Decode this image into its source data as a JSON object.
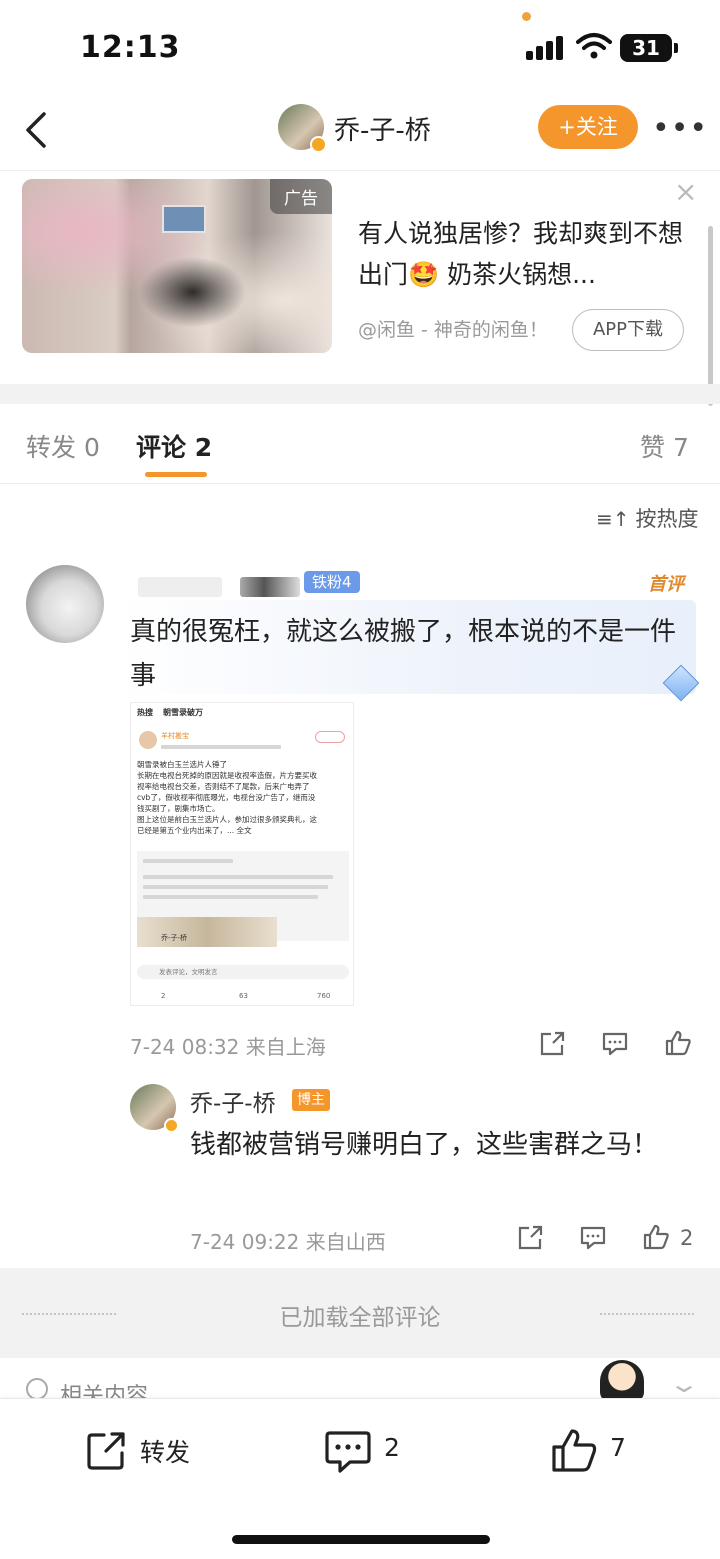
{
  "status_bar": {
    "time": "12:13",
    "battery": "31"
  },
  "nav": {
    "username": "乔-子-桥",
    "follow_label": "+关注",
    "more": "•••"
  },
  "ad": {
    "tag": "广告",
    "title": "有人说独居惨？我却爽到不想出门🤩 奶茶火锅想...",
    "source": "@闲鱼 - 神奇的闲鱼！",
    "download_label": "APP下载",
    "close": "×"
  },
  "tabs": {
    "repost": "转发 0",
    "comments": "评论 2",
    "likes": "赞 7"
  },
  "sort": {
    "icon": "≡↑",
    "label": "按热度"
  },
  "comment": {
    "fan_badge": "铁粉4",
    "first_tag": "首评",
    "text": "真的很冤枉，就这么被搬了，根本说的不是一件事",
    "meta": "7-24 08:32  来自上海",
    "screenshot": {
      "header_left": "热搜",
      "header_right": "朝雪录破万",
      "name": "羊村搬宝",
      "lines": [
        "朝雪录被白玉兰选片人锤了",
        "长期在电视台死掉的原因就是收视率造假，片方要买收",
        "视率给电视台交差，否则结不了尾款，后来广电弄了",
        "cvb了，假收视率彻底曝光，电视台没广告了，继而没",
        "钱买剧了，剧集市场亡。",
        "图上这位是前白玉兰选片人，参加过很多颁奖典礼，这",
        "已经是第五个业内出来了，... 全文"
      ],
      "quote_name": "乔-子-桥",
      "input_placeholder": "发表评论，文明发言",
      "repost_count": "2",
      "comment_count": "63",
      "like_count": "760"
    }
  },
  "reply": {
    "name": "乔-子-桥",
    "badge": "博主",
    "text": "钱都被营销号赚明白了，这些害群之马！",
    "meta": "7-24 09:22  来自山西",
    "like_count": "2"
  },
  "loaded_all": "已加载全部评论",
  "related": "相关内容",
  "bottom_bar": {
    "repost_label": "转发",
    "comment_count": "2",
    "like_count": "7"
  }
}
